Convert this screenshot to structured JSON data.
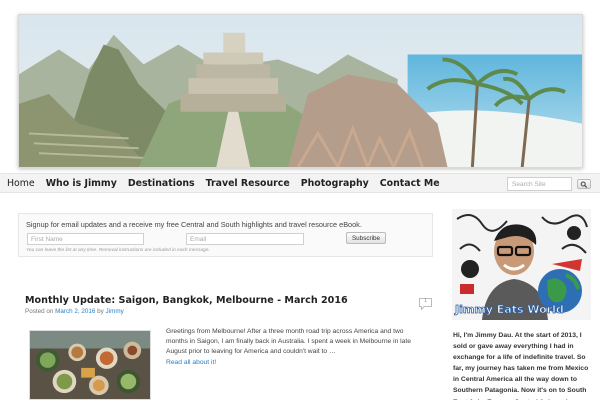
{
  "nav": {
    "items": [
      {
        "label": "Home",
        "name": "nav-home"
      },
      {
        "label": "Who is Jimmy",
        "name": "nav-who-is-jimmy"
      },
      {
        "label": "Destinations",
        "name": "nav-destinations"
      },
      {
        "label": "Travel Resource",
        "name": "nav-travel-resource"
      },
      {
        "label": "Photography",
        "name": "nav-photography"
      },
      {
        "label": "Contact Me",
        "name": "nav-contact-me"
      }
    ],
    "search_placeholder": "Search Site"
  },
  "signup": {
    "text": "Signup for email updates and a receive my free Central and South highlights and travel resource eBook.",
    "first_name_placeholder": "First Name",
    "email_placeholder": "Email",
    "button_label": "Subscribe",
    "note": "You can leave the list at any time. Removal instructions are included in each message."
  },
  "post": {
    "title": "Monthly Update: Saigon, Bangkok, Melbourne - March 2016",
    "meta_prefix": "Posted on",
    "date": "March 2, 2016",
    "meta_by": "by",
    "author": "Jimmy",
    "comment_count": "1",
    "excerpt": "Greetings from Melbourne! After a three month road trip across America and two months in Saigon, I am finally back in Australia. I spent a week in Melbourne in late August prior to leaving for America and couldn't wait to …",
    "read_more": "Read all about it!"
  },
  "sidebar": {
    "logo_text": "Jimmy Eats World",
    "bio": "Hi, I'm Jimmy Dau. At the start of 2013, I sold or gave away everything I had in exchange for a life of indefinite travel. So far, my journey has taken me from Mexico in Central America all the way down to Southern Patagonia. Now it's on to South East Asia, Europe, Central Asia and"
  },
  "colors": {
    "link": "#2a7ec4",
    "nav_bg": "#f3f3f3",
    "text": "#333333"
  }
}
